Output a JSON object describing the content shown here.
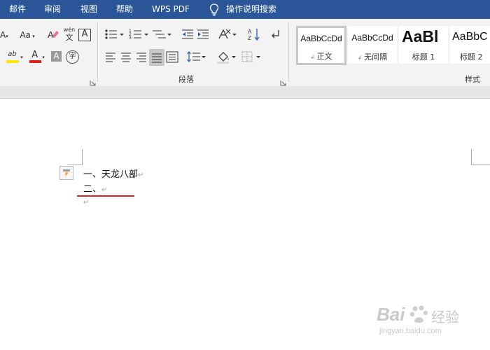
{
  "menu": {
    "items": [
      "邮件",
      "审阅",
      "视图",
      "帮助",
      "WPS PDF"
    ],
    "search_label": "操作说明搜索"
  },
  "ribbon": {
    "font_group": {
      "font_size_label": "Aa",
      "partial_glyph": "A",
      "wen_glyph": "wén",
      "wen_char": "文",
      "boxed_a": "A",
      "char_shading": "A",
      "font_color_glyph": "A",
      "enclosed_char": "字",
      "highlight_glyph": "ab"
    },
    "paragraph_group": {
      "label": "段落"
    },
    "styles_group": {
      "label": "样式",
      "items": [
        {
          "preview": "AaBbCcDd",
          "name": "正文",
          "selected": true
        },
        {
          "preview": "AaBbCcDd",
          "name": "无间隔",
          "selected": false
        },
        {
          "preview": "AaBl",
          "name": "标题 1",
          "selected": false
        },
        {
          "preview": "AaBbC",
          "name": "标题 2",
          "selected": false
        }
      ]
    }
  },
  "document": {
    "line1": "一、天龙八部",
    "line2": "二、",
    "paragraph_mark": "↵"
  },
  "watermark": {
    "brand": "Bai",
    "brand_suffix": "经验",
    "url": "jingyan.baidu.com"
  },
  "colors": {
    "menubar": "#2b579a",
    "highlight_yellow": "#ffe600",
    "font_red": "#e0201b",
    "spell_underline": "#d9262b"
  }
}
